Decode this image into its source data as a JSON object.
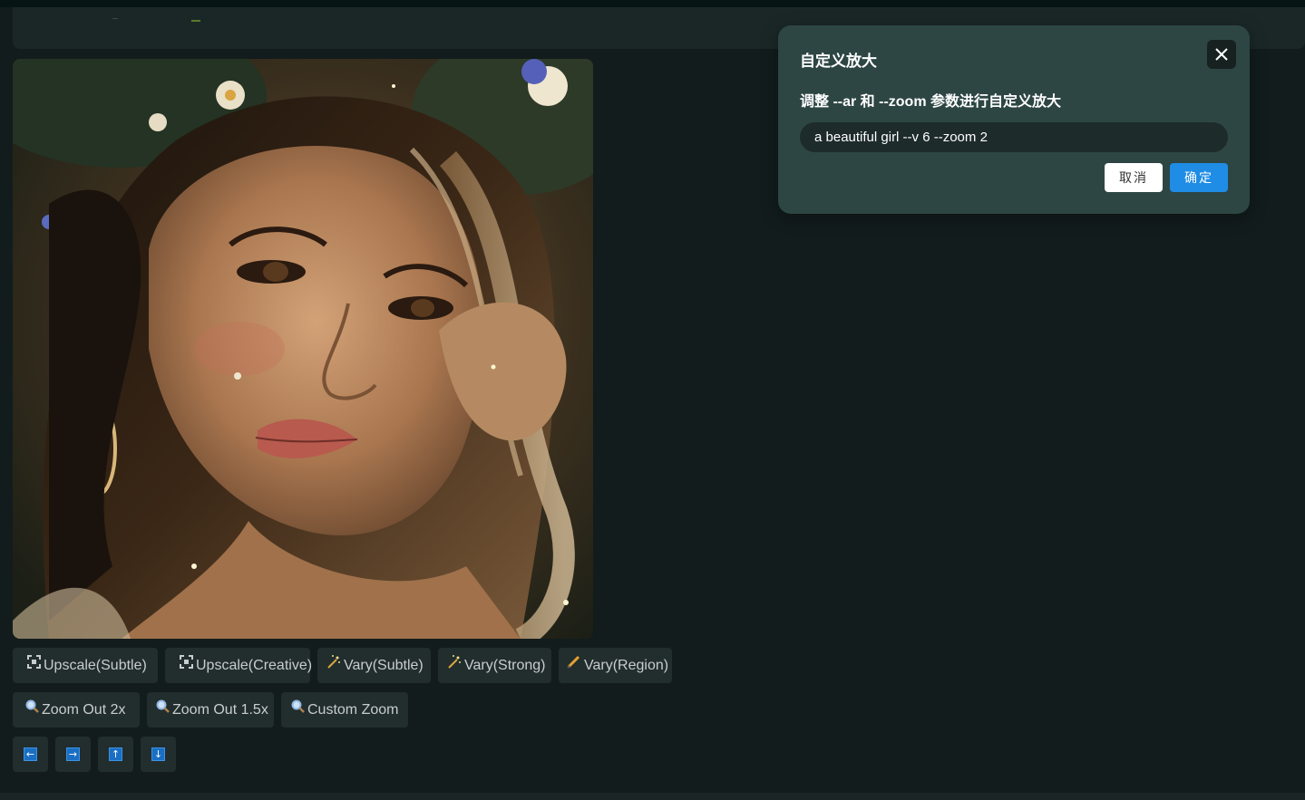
{
  "dialog": {
    "title": "自定义放大",
    "description": "调整 --ar 和 --zoom 参数进行自定义放大",
    "prompt_value": "a beautiful girl --v 6 --zoom 2",
    "cancel_label": "取消",
    "confirm_label": "确定",
    "close_icon": "close-icon"
  },
  "actions_row1": [
    {
      "label": "Upscale(Subtle)",
      "icon": "expand-icon"
    },
    {
      "label": "Upscale(Creative)",
      "icon": "expand-icon"
    },
    {
      "label": "Vary(Subtle)",
      "icon": "magic-wand-icon"
    },
    {
      "label": "Vary(Strong)",
      "icon": "magic-wand-icon"
    },
    {
      "label": "Vary(Region)",
      "icon": "pencil-icon"
    }
  ],
  "actions_row2": [
    {
      "label": "Zoom Out 2x",
      "icon": "magnifier-icon"
    },
    {
      "label": "Zoom Out 1.5x",
      "icon": "magnifier-icon"
    },
    {
      "label": "Custom Zoom",
      "icon": "magnifier-icon"
    }
  ],
  "pan_buttons": [
    {
      "glyph": "←",
      "icon": "arrow-left-icon"
    },
    {
      "glyph": "→",
      "icon": "arrow-right-icon"
    },
    {
      "glyph": "↑",
      "icon": "arrow-up-icon"
    },
    {
      "glyph": "↓",
      "icon": "arrow-down-icon"
    }
  ],
  "colors": {
    "background": "#121c1c",
    "dialog_bg": "#2d4644",
    "confirm_button": "#1f8ce5",
    "button_bg": "#222d2d"
  }
}
